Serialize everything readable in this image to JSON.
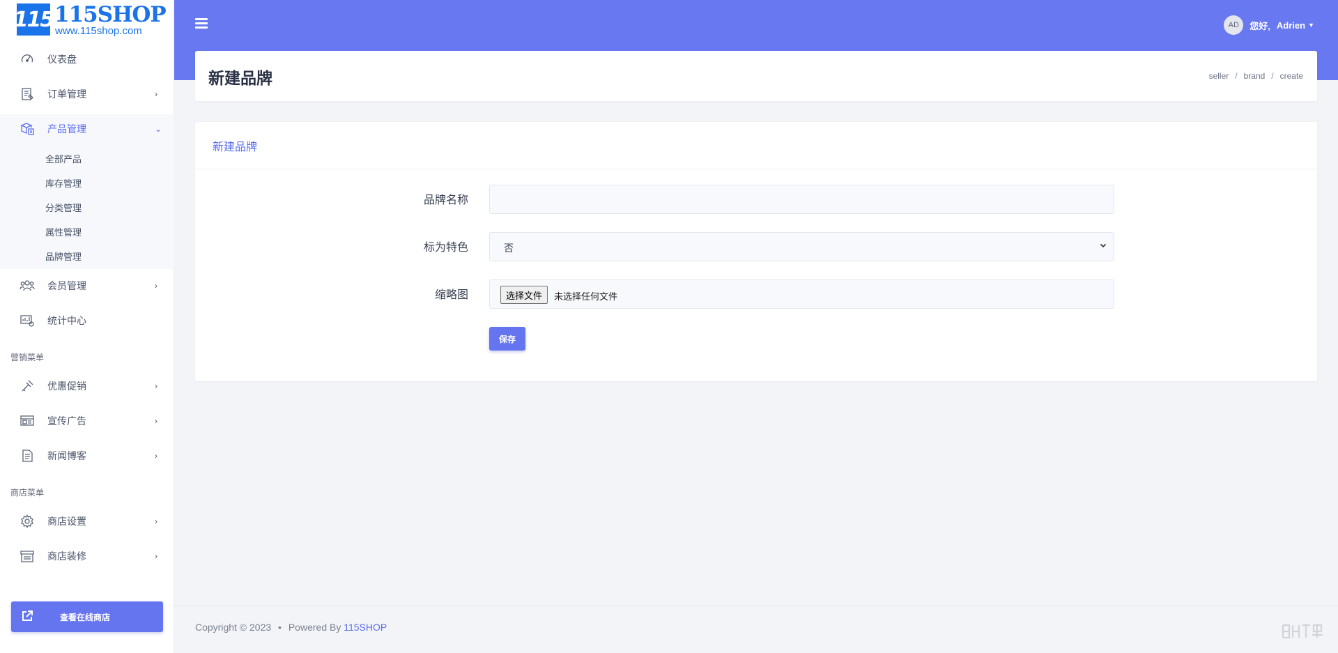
{
  "logo": {
    "mark": "115",
    "title": "115SHOP",
    "url": "www.115shop.com"
  },
  "sidebar": {
    "items": [
      {
        "label": "仪表盘",
        "icon": "dashboard-icon"
      },
      {
        "label": "订单管理",
        "icon": "orders-icon"
      },
      {
        "label": "产品管理",
        "icon": "products-icon"
      },
      {
        "label": "会员管理",
        "icon": "members-icon"
      },
      {
        "label": "统计中心",
        "icon": "stats-icon"
      }
    ],
    "product_submenu": [
      "全部产品",
      "库存管理",
      "分类管理",
      "属性管理",
      "品牌管理"
    ],
    "marketing_section": "营销菜单",
    "marketing_items": [
      {
        "label": "优惠促销",
        "icon": "promotion-icon"
      },
      {
        "label": "宣传广告",
        "icon": "ads-icon"
      },
      {
        "label": "新闻博客",
        "icon": "blog-icon"
      }
    ],
    "shop_section": "商店菜单",
    "shop_items": [
      {
        "label": "商店设置",
        "icon": "gear-icon"
      },
      {
        "label": "商店装修",
        "icon": "storefront-icon"
      }
    ],
    "view_shop_button": "查看在线商店"
  },
  "header": {
    "avatar_initials": "AD",
    "greeting": "您好,",
    "username": "Adrien"
  },
  "page": {
    "title": "新建品牌",
    "breadcrumb": [
      "seller",
      "brand",
      "create"
    ]
  },
  "form": {
    "title": "新建品牌",
    "name_label": "品牌名称",
    "name_value": "",
    "featured_label": "标为特色",
    "featured_value": "否",
    "thumbnail_label": "缩略图",
    "file_button": "选择文件",
    "file_status": "未选择任何文件",
    "save_button": "保存"
  },
  "footer": {
    "copyright": "Copyright © 2023",
    "dot": "•",
    "powered_by": "Powered By",
    "brand": "115SHOP"
  },
  "colors": {
    "accent": "#6878f0",
    "button": "#6574ef",
    "active_text": "#5b6ef0",
    "logo_blue": "#1a73e8"
  }
}
